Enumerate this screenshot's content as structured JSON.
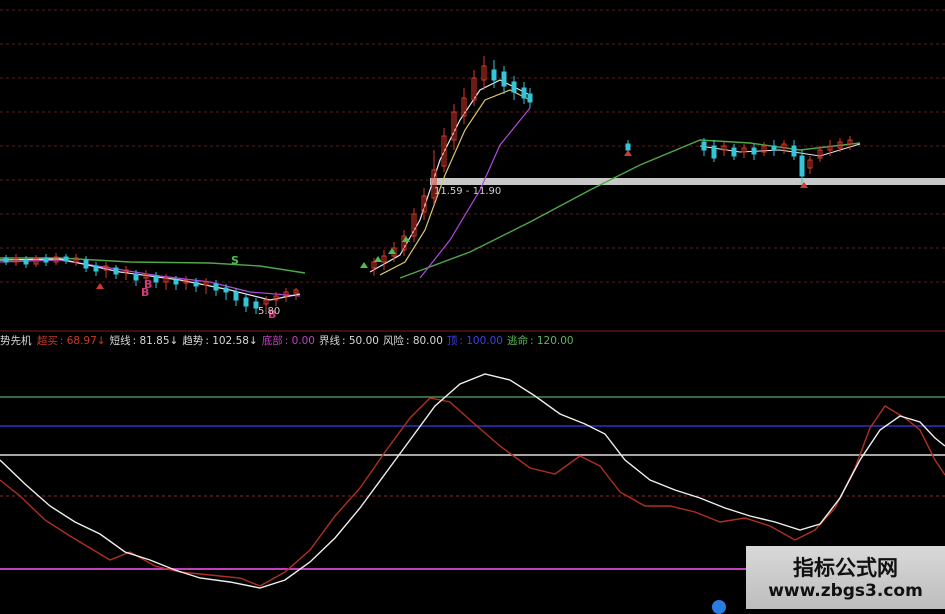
{
  "colors": {
    "background": "#000000",
    "candle_up": "#d63a2a",
    "candle_down": "#36c4d8",
    "ma_white": "#e8e8e8",
    "ma_yellow": "#d8c96a",
    "ma_purple": "#b04adf",
    "ma_green": "#4fa84a",
    "support_band": "#c8c8c8",
    "dashed_grid": "#5a1e1e",
    "fast_line": "#b03020",
    "slow_line": "#efefef",
    "hl_green": "#5aa85a",
    "hl_blue": "#3030c8",
    "hl_white": "#dedede",
    "hl_magenta": "#c040c0"
  },
  "price_panel": {
    "range_label": "11.59 - 11.90",
    "low_label": "5.80"
  },
  "signals": [
    {
      "text": "S",
      "kind": "sell"
    },
    {
      "text": "B",
      "kind": "buy"
    },
    {
      "text": "B",
      "kind": "buy"
    },
    {
      "text": "B",
      "kind": "buy"
    }
  ],
  "indicator": {
    "name": "势先机",
    "items": [
      {
        "label": "超买",
        "value": "68.97",
        "arrow": "↓",
        "color": "#c83a2a"
      },
      {
        "label": "短线",
        "value": "81.85",
        "arrow": "↓",
        "color": "#d8d8d8"
      },
      {
        "label": "趋势",
        "value": "102.58",
        "arrow": "↓",
        "color": "#d8d8d8"
      },
      {
        "label": "底部",
        "value": "0.00",
        "arrow": "",
        "color": "#c040c0"
      },
      {
        "label": "界线",
        "value": "50.00",
        "arrow": "",
        "color": "#d8d8d8"
      },
      {
        "label": "风险",
        "value": "80.00",
        "arrow": "",
        "color": "#d8d8d8"
      },
      {
        "label": "顶",
        "value": "100.00",
        "arrow": "",
        "color": "#4040e0"
      },
      {
        "label": "逃命",
        "value": "120.00",
        "arrow": "",
        "color": "#5ab85a"
      }
    ]
  },
  "watermark": {
    "title": "指标公式网",
    "url": "www.zbgs3.com"
  }
}
